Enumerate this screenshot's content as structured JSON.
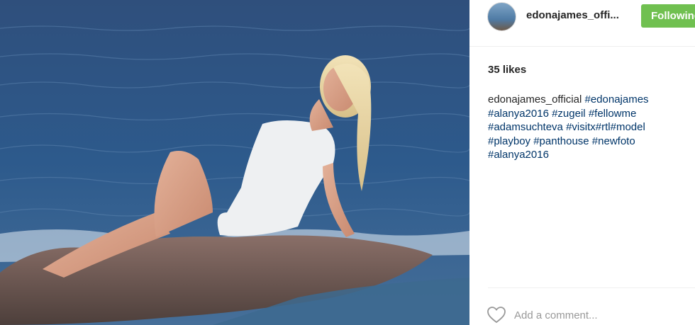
{
  "post": {
    "image_alt": "Woman in white dress sitting on a rock by the sea",
    "likes_text": "35 likes"
  },
  "header": {
    "username": "edonajames_offi...",
    "follow_label": "Following"
  },
  "caption": {
    "username": "edonajames_official",
    "hashtags": [
      "#edonajames",
      "#alanya2016",
      "#zugeil",
      "#fellowme",
      "#adamsuchteva",
      "#visitx",
      "#rtl",
      "#model",
      "#playboy",
      "#panthouse",
      "#newfoto",
      "#alanya2016"
    ]
  },
  "comment": {
    "placeholder": "Add a comment..."
  },
  "colors": {
    "follow_button": "#70c050",
    "hashtag": "#003569",
    "text": "#262626",
    "placeholder": "#999999"
  },
  "icons": {
    "like": "heart-outline-icon"
  }
}
